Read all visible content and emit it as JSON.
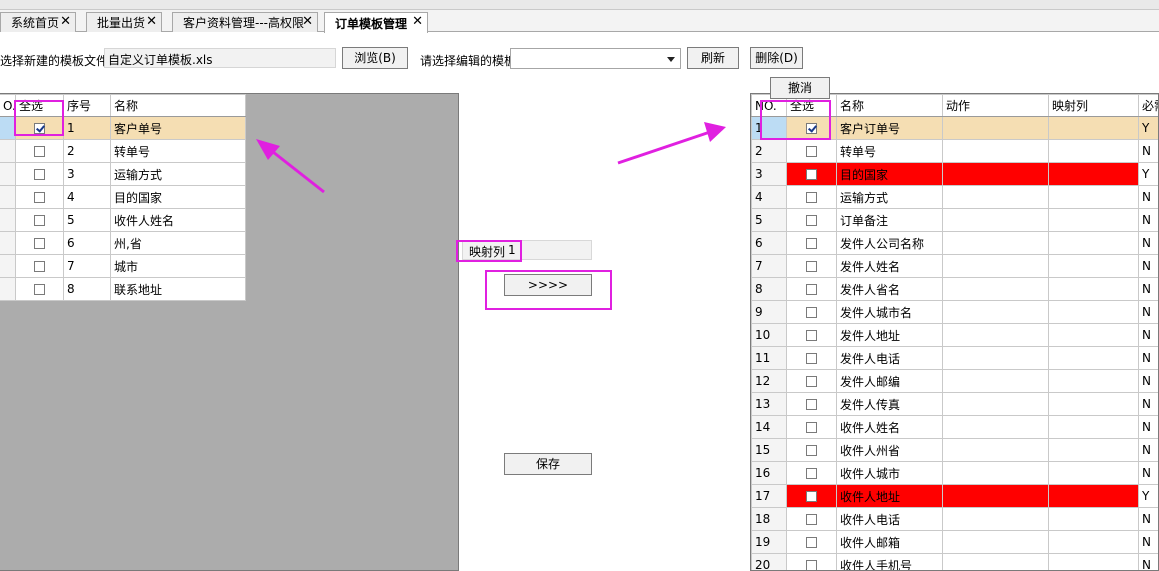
{
  "tabs": [
    {
      "label": "系统首页",
      "close": "✕"
    },
    {
      "label": "批量出货",
      "close": "✕"
    },
    {
      "label": "客户资料管理---高权限",
      "close": "✕"
    },
    {
      "label": "订单模板管理",
      "close": "✕"
    }
  ],
  "toolbar": {
    "file_label": "选择新建的模板文件",
    "file_value": "自定义订单模板.xls",
    "browse_label": "浏览(B)",
    "template_label": "请选择编辑的模板",
    "template_value": "",
    "refresh_label": "刷新",
    "delete_label": "删除(D)",
    "cancel_label": "撤消"
  },
  "left_grid": {
    "row_header": "O.",
    "headers": [
      "全选",
      "序号",
      "名称"
    ],
    "rows": [
      {
        "checked": true,
        "seq": "1",
        "name": "客户单号"
      },
      {
        "checked": false,
        "seq": "2",
        "name": "转单号"
      },
      {
        "checked": false,
        "seq": "3",
        "name": "运输方式"
      },
      {
        "checked": false,
        "seq": "4",
        "name": "目的国家"
      },
      {
        "checked": false,
        "seq": "5",
        "name": "收件人姓名"
      },
      {
        "checked": false,
        "seq": "6",
        "name": "州,省"
      },
      {
        "checked": false,
        "seq": "7",
        "name": "城市"
      },
      {
        "checked": false,
        "seq": "8",
        "name": "联系地址"
      }
    ]
  },
  "center": {
    "map_label": "映射列",
    "map_value": "1",
    "move_button": ">>>>",
    "save_button": "保存"
  },
  "right_grid": {
    "headers": [
      "NO.",
      "全选",
      "名称",
      "动作",
      "映射列",
      "必需"
    ],
    "rows": [
      {
        "no": "1",
        "checked": true,
        "name": "客户订单号",
        "action": "",
        "map": "",
        "req": "Y",
        "state": "selected"
      },
      {
        "no": "2",
        "checked": false,
        "name": "转单号",
        "action": "",
        "map": "",
        "req": "N",
        "state": ""
      },
      {
        "no": "3",
        "checked": false,
        "name": "目的国家",
        "action": "",
        "map": "",
        "req": "Y",
        "state": "red"
      },
      {
        "no": "4",
        "checked": false,
        "name": "运输方式",
        "action": "",
        "map": "",
        "req": "N",
        "state": ""
      },
      {
        "no": "5",
        "checked": false,
        "name": "订单备注",
        "action": "",
        "map": "",
        "req": "N",
        "state": ""
      },
      {
        "no": "6",
        "checked": false,
        "name": "发件人公司名称",
        "action": "",
        "map": "",
        "req": "N",
        "state": ""
      },
      {
        "no": "7",
        "checked": false,
        "name": "发件人姓名",
        "action": "",
        "map": "",
        "req": "N",
        "state": ""
      },
      {
        "no": "8",
        "checked": false,
        "name": "发件人省名",
        "action": "",
        "map": "",
        "req": "N",
        "state": ""
      },
      {
        "no": "9",
        "checked": false,
        "name": "发件人城市名",
        "action": "",
        "map": "",
        "req": "N",
        "state": ""
      },
      {
        "no": "10",
        "checked": false,
        "name": "发件人地址",
        "action": "",
        "map": "",
        "req": "N",
        "state": ""
      },
      {
        "no": "11",
        "checked": false,
        "name": "发件人电话",
        "action": "",
        "map": "",
        "req": "N",
        "state": ""
      },
      {
        "no": "12",
        "checked": false,
        "name": "发件人邮编",
        "action": "",
        "map": "",
        "req": "N",
        "state": ""
      },
      {
        "no": "13",
        "checked": false,
        "name": "发件人传真",
        "action": "",
        "map": "",
        "req": "N",
        "state": ""
      },
      {
        "no": "14",
        "checked": false,
        "name": "收件人姓名",
        "action": "",
        "map": "",
        "req": "N",
        "state": ""
      },
      {
        "no": "15",
        "checked": false,
        "name": "收件人州省",
        "action": "",
        "map": "",
        "req": "N",
        "state": ""
      },
      {
        "no": "16",
        "checked": false,
        "name": "收件人城市",
        "action": "",
        "map": "",
        "req": "N",
        "state": ""
      },
      {
        "no": "17",
        "checked": false,
        "name": "收件人地址",
        "action": "",
        "map": "",
        "req": "Y",
        "state": "red"
      },
      {
        "no": "18",
        "checked": false,
        "name": "收件人电话",
        "action": "",
        "map": "",
        "req": "N",
        "state": ""
      },
      {
        "no": "19",
        "checked": false,
        "name": "收件人邮箱",
        "action": "",
        "map": "",
        "req": "N",
        "state": ""
      },
      {
        "no": "20",
        "checked": false,
        "name": "收件人手机号",
        "action": "",
        "map": "",
        "req": "N",
        "state": ""
      }
    ]
  },
  "colors": {
    "highlight": "#e020e0",
    "selected_row": "#f5deb3",
    "required_row": "#ff0000",
    "panel_gray": "#acacac"
  }
}
